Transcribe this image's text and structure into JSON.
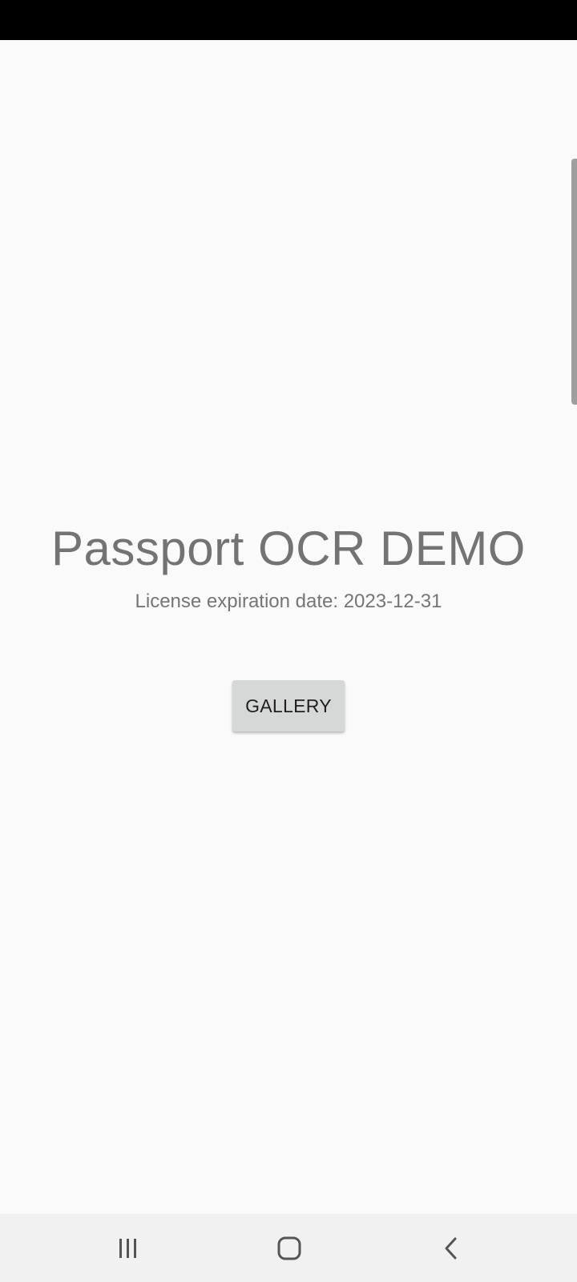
{
  "app": {
    "title": "Passport OCR DEMO",
    "license_text": "License expiration date: 2023-12-31",
    "gallery_button_label": "GALLERY"
  },
  "navigation_bar": {
    "items": [
      {
        "icon": "recents-icon"
      },
      {
        "icon": "home-icon"
      },
      {
        "icon": "back-icon"
      }
    ]
  },
  "colors": {
    "background": "#fafafa",
    "status_bar": "#000000",
    "title_text": "#737373",
    "button_background": "#d6d7d7",
    "button_text": "#1f1f1f",
    "nav_bar": "#f1f1f1",
    "nav_icon": "#555555"
  }
}
